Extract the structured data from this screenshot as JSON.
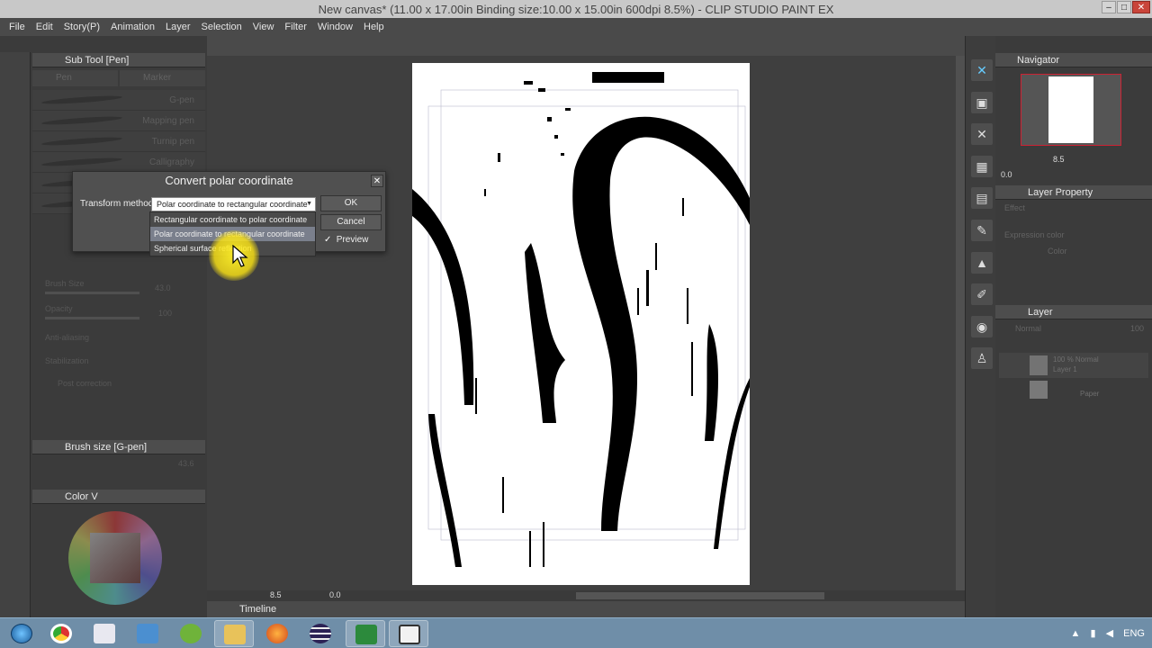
{
  "window": {
    "title": "New canvas* (11.00 x 17.00in Binding size:10.00 x 15.00in 600dpi 8.5%)  - CLIP STUDIO PAINT EX"
  },
  "menu": [
    "File",
    "Edit",
    "Story(P)",
    "Animation",
    "Layer",
    "Selection",
    "View",
    "Filter",
    "Window",
    "Help"
  ],
  "left_panel": {
    "subtool_title": "Sub Tool [Pen]",
    "tabs": [
      "Pen",
      "Marker"
    ],
    "brushes": [
      "G-pen",
      "Mapping pen",
      "Turnip pen",
      "Calligraphy",
      "",
      ""
    ],
    "props": {
      "brush_size_label": "Brush Size",
      "brush_size_value": "43.0",
      "opacity_label": "Opacity",
      "opacity_value": "100",
      "antialias_label": "Anti-aliasing",
      "stabilization_label": "Stabilization",
      "post_correction_label": "Post correction"
    },
    "brush_size_panel_title": "Brush size [G-pen]",
    "brush_size_panel_value": "43.6",
    "color_panel_title": "Color V"
  },
  "dialog": {
    "title": "Convert polar coordinate",
    "transform_label": "Transform method:",
    "selected_value": "Polar coordinate to rectangular coordinate",
    "options": [
      "Rectangular coordinate to polar coordinate",
      "Polar coordinate to rectangular coordinate",
      "Spherical surface reflection"
    ],
    "ok": "OK",
    "cancel": "Cancel",
    "preview": "Preview",
    "preview_checked": true
  },
  "status": {
    "zoom": "8.5",
    "angle": "0.0"
  },
  "timeline_label": "Timeline",
  "right_panel": {
    "navigator_title": "Navigator",
    "navigator_zoom": "8.5",
    "navigator_angle": "0.0",
    "layer_property_title": "Layer Property",
    "effect_label": "Effect",
    "expression_color_label": "Expression color",
    "color_label": "Color",
    "layer_title": "Layer",
    "blend_mode": "Normal",
    "opacity": "100",
    "layers": [
      {
        "opacity": "100 %  Normal",
        "name": "Layer 1"
      },
      {
        "opacity": "",
        "name": "Paper"
      }
    ]
  },
  "taskbar": {
    "apps": [
      "Windows start",
      "Chrome",
      "Notes",
      "Explorer",
      "Android",
      "Folder",
      "Firefox",
      "Eclipse",
      "Clip Studio",
      "Clip Studio Paint"
    ],
    "language": "ENG"
  }
}
